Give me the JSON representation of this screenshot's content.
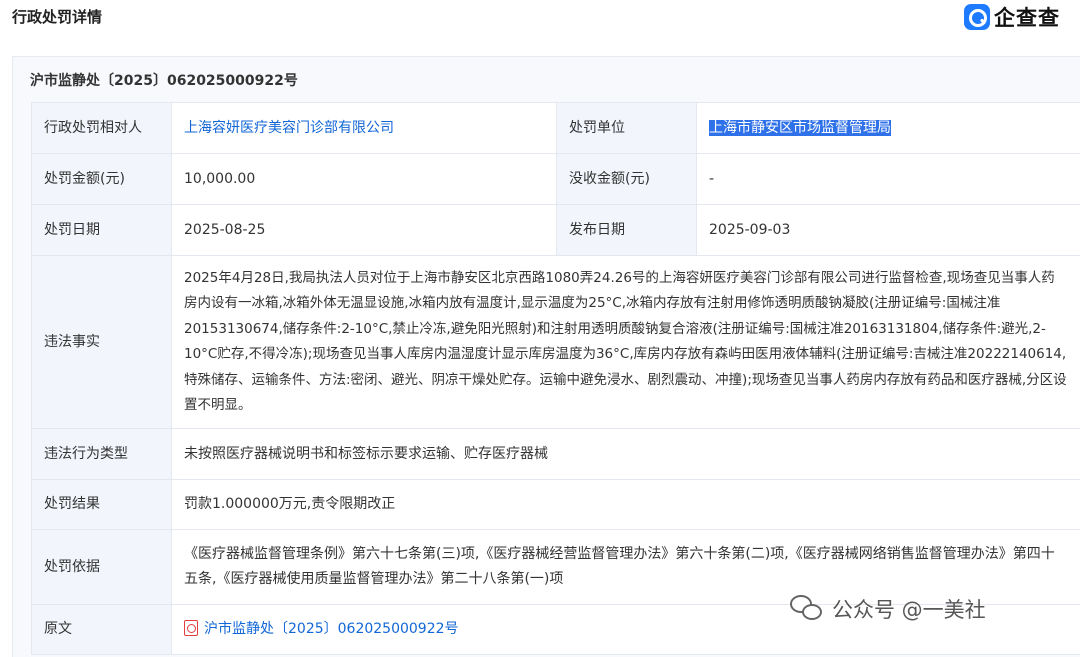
{
  "header": {
    "title": "行政处罚详情",
    "logo_text": "企查查"
  },
  "doc_number": "沪市监静处〔2025〕062025000922号",
  "rows": {
    "party": {
      "label": "行政处罚相对人",
      "value": "上海容妍医疗美容门诊部有限公司"
    },
    "authority": {
      "label": "处罚单位",
      "value": "上海市静安区市场监督管理局"
    },
    "amount": {
      "label": "处罚金额(元)",
      "value": "10,000.00"
    },
    "confiscation": {
      "label": "没收金额(元)",
      "value": "-"
    },
    "date": {
      "label": "处罚日期",
      "value": "2025-08-25"
    },
    "publish_date": {
      "label": "发布日期",
      "value": "2025-09-03"
    },
    "facts": {
      "label": "违法事实",
      "value": "2025年4月28日,我局执法人员对位于上海市静安区北京西路1080弄24.26号的上海容妍医疗美容门诊部有限公司进行监督检查,现场查见当事人药房内设有一冰箱,冰箱外体无温显设施,冰箱内放有温度计,显示温度为25°C,冰箱内存放有注射用修饰透明质酸钠凝胶(注册证编号:国械注准20153130674,储存条件:2-10°C,禁止冷冻,避免阳光照射)和注射用透明质酸钠复合溶液(注册证编号:国械注准20163131804,储存条件:避光,2-10°C贮存,不得冷冻);现场查见当事人库房内温湿度计显示库房温度为36°C,库房内存放有森屿田医用液体辅料(注册证编号:吉械注准20222140614,特殊储存、运输条件、方法:密闭、避光、阴凉干燥处贮存。运输中避免浸水、剧烈震动、冲撞);现场查见当事人药房内存放有药品和医疗器械,分区设置不明显。"
    },
    "violation_type": {
      "label": "违法行为类型",
      "value": "未按照医疗器械说明书和标签标示要求运输、贮存医疗器械"
    },
    "result": {
      "label": "处罚结果",
      "value": "罚款1.000000万元,责令限期改正"
    },
    "basis": {
      "label": "处罚依据",
      "value": "《医疗器械监督管理条例》第六十七条第(三)项,《医疗器械经营监督管理办法》第六十条第(二)项,《医疗器械网络销售监督管理办法》第四十五条,《医疗器械使用质量监督管理办法》第二十八条第(一)项"
    },
    "original": {
      "label": "原文",
      "value": "沪市监静处〔2025〕062025000922号"
    }
  },
  "watermark": {
    "text": "公众号 @一美社"
  },
  "colors": {
    "link": "#1266d6",
    "selection": "#2f71e8",
    "label_bg": "#f2f6fc",
    "brand": "#1e7bff"
  }
}
